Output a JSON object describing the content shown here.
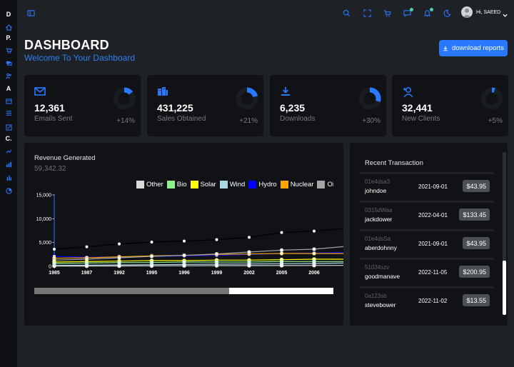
{
  "sidebar": {
    "letters": [
      "D",
      "P.",
      "A",
      "C."
    ],
    "icons": [
      "home-icon",
      "contacts-icon",
      "cart-icon",
      "layers-icon",
      "people-icon",
      "calendar-icon",
      "list-icon",
      "edit-icon",
      "chart-line-icon",
      "bar-chart-icon",
      "chart-bars-icon",
      "pie-chart-icon"
    ]
  },
  "topbar": {
    "user_greeting": "Hi, SAEED",
    "icons": [
      "sidebar-toggle-icon",
      "search-icon",
      "fullscreen-icon",
      "cart-icon",
      "chat-icon",
      "bell-icon",
      "moon-icon",
      "user-icon",
      "chevron-down-icon"
    ]
  },
  "header": {
    "title": "DASHBOARD",
    "subtitle": "Welcome To Your Dashboard",
    "download_label": "download reports"
  },
  "stats": [
    {
      "value": "12,361",
      "label": "Emails Sent",
      "change": "+14%",
      "progress": 0.14,
      "icon": "mail-icon"
    },
    {
      "value": "431,225",
      "label": "Sales Obtained",
      "change": "+21%",
      "progress": 0.21,
      "icon": "building-icon"
    },
    {
      "value": "6,235",
      "label": "Downloads",
      "change": "+30%",
      "progress": 0.3,
      "icon": "download-icon"
    },
    {
      "value": "32,441",
      "label": "New Clients",
      "change": "+5%",
      "progress": 0.05,
      "icon": "add-user-icon"
    }
  ],
  "revenue": {
    "title": "Revenue Generated",
    "value": "59,342.32"
  },
  "chart_data": {
    "type": "line",
    "categories": [
      "1985",
      "1987",
      "1992",
      "1995",
      "1996",
      "1999",
      "2002",
      "2005",
      "2006"
    ],
    "ylim": [
      0,
      15000
    ],
    "yticks": [
      "15,000",
      "10,000",
      "5,000",
      "0"
    ],
    "legend_position": "top-right",
    "legend": [
      {
        "name": "Other",
        "color": "#d9d9d9"
      },
      {
        "name": "Bio",
        "color": "#90ee90"
      },
      {
        "name": "Solar",
        "color": "#ffff00"
      },
      {
        "name": "Wind",
        "color": "#add8e6"
      },
      {
        "name": "Hydro",
        "color": "#0000ff"
      },
      {
        "name": "Nuclear",
        "color": "#ffa500"
      },
      {
        "name": "Oi",
        "color": "#a6a6a6"
      }
    ],
    "series": [
      {
        "color": "#000000",
        "values": [
          3600,
          4100,
          4700,
          5100,
          5300,
          5600,
          6100,
          7100,
          7400,
          8000
        ]
      },
      {
        "color": "#0000ff",
        "values": [
          2100,
          1900,
          2000,
          2100,
          2200,
          2300,
          2500,
          2700,
          2800,
          2900
        ]
      },
      {
        "color": "#ffa500",
        "values": [
          1700,
          1800,
          2000,
          2200,
          2300,
          2500,
          2600,
          2700,
          2700,
          2700
        ]
      },
      {
        "color": "#a6a6a6",
        "values": [
          1300,
          1500,
          1800,
          2100,
          2300,
          2600,
          3000,
          3400,
          3600,
          4200
        ]
      },
      {
        "color": "#ffff00",
        "values": [
          900,
          1000,
          1100,
          1200,
          1200,
          1300,
          1300,
          1400,
          1500,
          1500
        ]
      },
      {
        "color": "#90ee90",
        "values": [
          600,
          700,
          800,
          800,
          900,
          900,
          900,
          1000,
          1000,
          1000
        ]
      },
      {
        "color": "#add8e6",
        "values": [
          200,
          250,
          300,
          350,
          400,
          450,
          500,
          550,
          600,
          700
        ]
      },
      {
        "color": "#d9d9d9",
        "values": [
          50,
          60,
          80,
          100,
          120,
          140,
          150,
          170,
          180,
          200
        ]
      }
    ]
  },
  "transactions": {
    "title": "Recent Transaction",
    "rows": [
      {
        "id": "01e4dsa3",
        "user": "johndoe",
        "date": "2021-09-01",
        "amount": "$43.95"
      },
      {
        "id": "0315dWaa",
        "user": "jackdower",
        "date": "2022-04-01",
        "amount": "$133.45"
      },
      {
        "id": "01e4dsSa",
        "user": "aberdohnny",
        "date": "2021-09-01",
        "amount": "$43.95"
      },
      {
        "id": "51034szv",
        "user": "goodmanave",
        "date": "2022-11-05",
        "amount": "$200.95"
      },
      {
        "id": "0a123sb",
        "user": "stevebower",
        "date": "2022-11-02",
        "amount": "$13.55"
      }
    ]
  },
  "colors": {
    "accent": "#2979ff",
    "background": "#1e2126",
    "panel": "#101216",
    "status_dot": "#4cceac"
  }
}
